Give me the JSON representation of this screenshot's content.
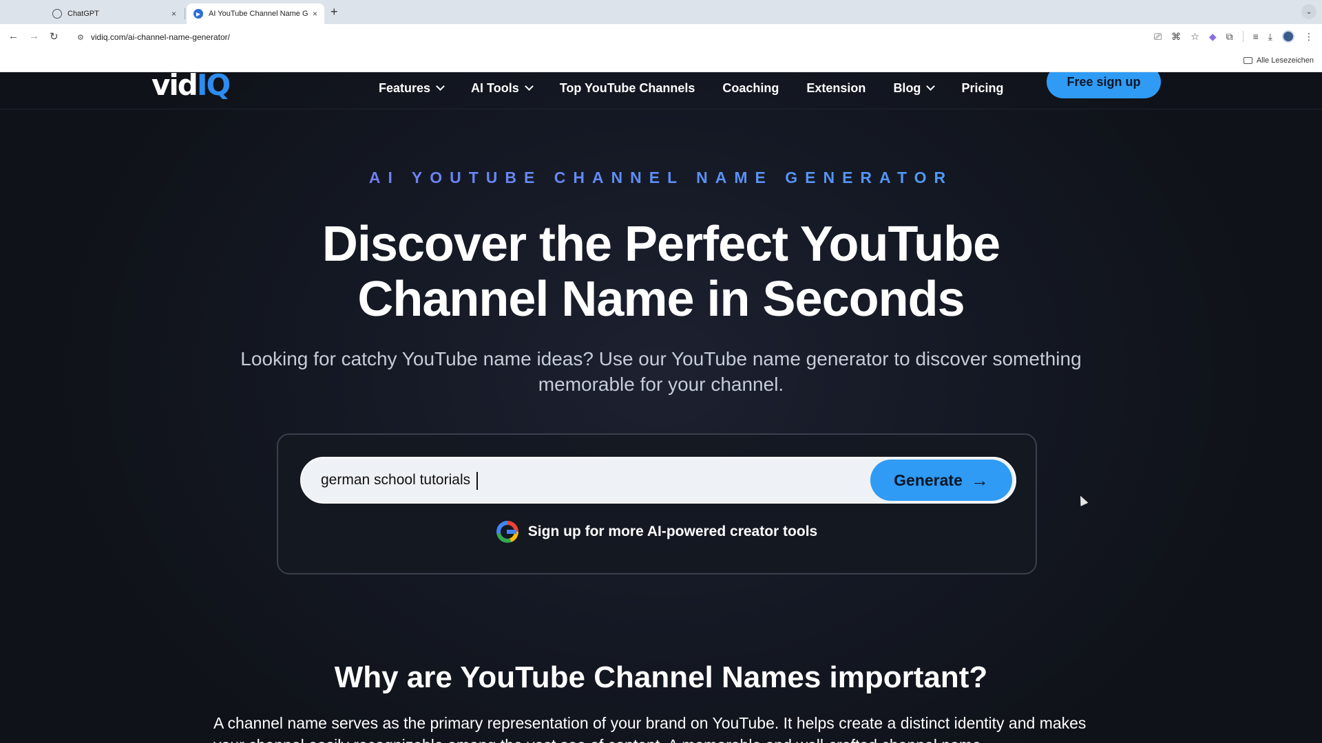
{
  "browser": {
    "tabs": [
      {
        "title": "ChatGPT",
        "active": false,
        "icon": "chatgpt-icon"
      },
      {
        "title": "AI YouTube Channel Name Ge",
        "active": true,
        "icon": "vidiq-icon"
      }
    ],
    "new_tab_glyph": "+",
    "close_glyph": "×",
    "url": "vidiq.com/ai-channel-name-generator/",
    "bookmarks_label": "Alle Lesezeichen"
  },
  "site": {
    "logo_main": "vid",
    "logo_accent": "IQ",
    "nav": [
      {
        "label": "Features",
        "dropdown": true
      },
      {
        "label": "AI Tools",
        "dropdown": true
      },
      {
        "label": "Top YouTube Channels",
        "dropdown": false
      },
      {
        "label": "Coaching",
        "dropdown": false
      },
      {
        "label": "Extension",
        "dropdown": false
      },
      {
        "label": "Blog",
        "dropdown": true
      },
      {
        "label": "Pricing",
        "dropdown": false
      }
    ],
    "signup_label": "Free sign up",
    "brand_color": "#2f9bf5"
  },
  "hero": {
    "eyebrow": "AI YOUTUBE CHANNEL NAME GENERATOR",
    "headline_line1": "Discover the Perfect YouTube",
    "headline_line2": "Channel Name in Seconds",
    "subhead": "Looking for catchy YouTube name ideas? Use our YouTube name generator to discover something memorable for your channel."
  },
  "generator": {
    "input_value": "german school tutorials",
    "button_label": "Generate",
    "google_signup": "Sign up for more AI-powered creator tools"
  },
  "section": {
    "heading": "Why are YouTube Channel Names important?",
    "body": "A channel name serves as the primary representation of your brand on YouTube. It helps create a distinct identity and makes your channel easily recognizable among the vast sea of content. A memorable and well-crafted channel name"
  }
}
